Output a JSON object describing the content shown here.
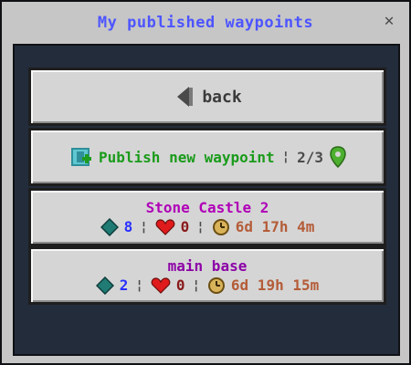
{
  "window": {
    "title": "My published waypoints"
  },
  "buttons": {
    "back": {
      "label": "back"
    },
    "publish": {
      "label": "Publish new waypoint",
      "count": "2/3",
      "separator": "¦"
    }
  },
  "waypoints": [
    {
      "name": "Stone Castle 2",
      "users": "8",
      "likes": "0",
      "age": "6d 17h 4m"
    },
    {
      "name": "main base",
      "users": "2",
      "likes": "0",
      "age": "6d 19h 15m"
    }
  ],
  "colors": {
    "title": "#4d55ff",
    "publish": "#1a9b1a",
    "waypoint_name": "#b000b8",
    "users": "#2930ff",
    "likes": "#8a1a1a",
    "age": "#b45c38"
  },
  "icons": {
    "close": "close-icon",
    "back": "back-arrow-icon",
    "publish": "globe-add-icon",
    "pin": "map-pin-icon",
    "users": "gem-icon",
    "likes": "heart-icon",
    "age": "clock-icon"
  }
}
